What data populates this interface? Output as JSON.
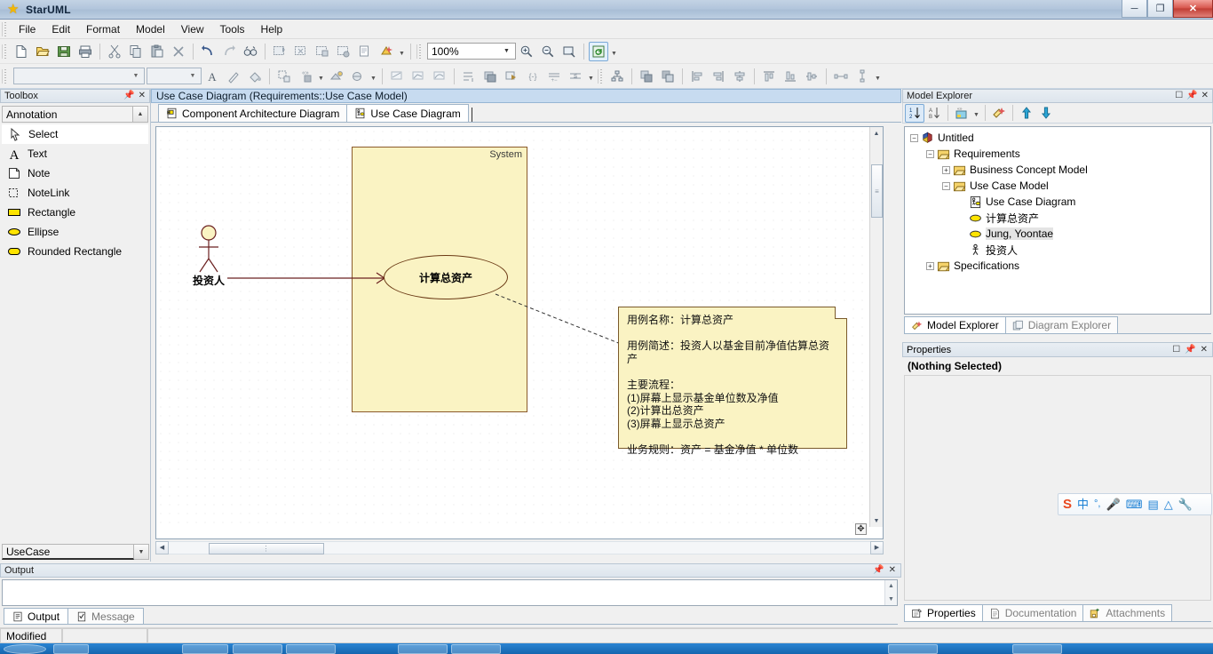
{
  "window": {
    "title": "StarUML",
    "minimize_label": "─",
    "maximize_label": "❐",
    "close_label": "✕"
  },
  "menubar": {
    "items": [
      {
        "label": "File"
      },
      {
        "label": "Edit"
      },
      {
        "label": "Format"
      },
      {
        "label": "Model"
      },
      {
        "label": "View"
      },
      {
        "label": "Tools"
      },
      {
        "label": "Help"
      }
    ]
  },
  "toolbar": {
    "zoom_level": "100%",
    "font_family_value": "",
    "font_size_value": ""
  },
  "toolbox": {
    "header": "Toolbox",
    "section": "Annotation",
    "footer_value": "UseCase",
    "items": [
      {
        "label": "Select",
        "icon": "cursor-icon"
      },
      {
        "label": "Text",
        "icon": "text-icon"
      },
      {
        "label": "Note",
        "icon": "note-icon"
      },
      {
        "label": "NoteLink",
        "icon": "notelink-icon"
      },
      {
        "label": "Rectangle",
        "icon": "rectangle-icon"
      },
      {
        "label": "Ellipse",
        "icon": "ellipse-icon"
      },
      {
        "label": "Rounded Rectangle",
        "icon": "rounded-rectangle-icon"
      }
    ]
  },
  "diagram": {
    "title": "Use Case Diagram (Requirements::Use Case Model)",
    "tabs": [
      {
        "label": "Component Architecture Diagram",
        "active": false
      },
      {
        "label": "Use Case Diagram",
        "active": true
      }
    ],
    "system_label": "System",
    "usecase_label": "计算总资产",
    "actor_label": "投资人",
    "note_lines": [
      "用例名称：计算总资产",
      "",
      "用例简述：投资人以基金目前净值估算总资产",
      "",
      "主要流程：",
      "(1)屏幕上显示基金单位数及净值",
      "(2)计算出总资产",
      "(3)屏幕上显示总资产",
      "",
      "业务规则：资产 = 基金净值 * 单位数"
    ]
  },
  "model_explorer": {
    "header": "Model Explorer",
    "tree": [
      {
        "label": "Untitled",
        "depth": 0,
        "expander": "minus",
        "icon": "package-model-icon"
      },
      {
        "label": "Requirements",
        "depth": 1,
        "expander": "minus",
        "icon": "folder-icon"
      },
      {
        "label": "Business Concept Model",
        "depth": 2,
        "expander": "plus",
        "icon": "folder-icon"
      },
      {
        "label": "Use Case Model",
        "depth": 2,
        "expander": "minus",
        "icon": "folder-icon"
      },
      {
        "label": "Use Case Diagram",
        "depth": 3,
        "expander": "none",
        "icon": "usecase-diagram-icon"
      },
      {
        "label": "计算总资产",
        "depth": 3,
        "expander": "none",
        "icon": "usecase-icon"
      },
      {
        "label": "Jung, Yoontae",
        "depth": 3,
        "expander": "none",
        "icon": "usecase-icon",
        "highlight": true
      },
      {
        "label": "投资人",
        "depth": 3,
        "expander": "none",
        "icon": "actor-icon"
      },
      {
        "label": "Specifications",
        "depth": 1,
        "expander": "plus",
        "icon": "folder-icon"
      }
    ],
    "tabs": [
      {
        "label": "Model Explorer",
        "active": true,
        "icon": "model-explorer-icon"
      },
      {
        "label": "Diagram Explorer",
        "active": false,
        "icon": "diagram-explorer-icon"
      }
    ]
  },
  "properties": {
    "header": "Properties",
    "selection": "(Nothing Selected)",
    "tabs": [
      {
        "label": "Properties",
        "active": true,
        "icon": "properties-icon"
      },
      {
        "label": "Documentation",
        "active": false,
        "icon": "documentation-icon"
      },
      {
        "label": "Attachments",
        "active": false,
        "icon": "attachments-icon"
      }
    ]
  },
  "output": {
    "header": "Output",
    "content": "",
    "tabs": [
      {
        "label": "Output",
        "active": true,
        "icon": "output-icon"
      },
      {
        "label": "Message",
        "active": false,
        "icon": "message-icon"
      }
    ]
  },
  "statusbar": {
    "state": "Modified",
    "field2": "",
    "field3": ""
  },
  "ime": {
    "items": [
      {
        "name": "sogou-logo-icon",
        "glyph": "S"
      },
      {
        "name": "chinese-mode-icon",
        "glyph": "中"
      },
      {
        "name": "punctuation-icon",
        "glyph": "°,"
      },
      {
        "name": "microphone-icon",
        "glyph": "ᵓ"
      },
      {
        "name": "keyboard-icon",
        "glyph": "⌨"
      },
      {
        "name": "toolbox-icon",
        "glyph": "⌸"
      },
      {
        "name": "skin-icon",
        "glyph": "ὅ5"
      },
      {
        "name": "settings-wrench-icon",
        "glyph": "ὒ7"
      }
    ]
  },
  "colors": {
    "diagram_fill": "#faf3c3",
    "diagram_stroke": "#7a5a2b",
    "title_active": "#c7dbf0",
    "accent": "#1a7fd4"
  }
}
